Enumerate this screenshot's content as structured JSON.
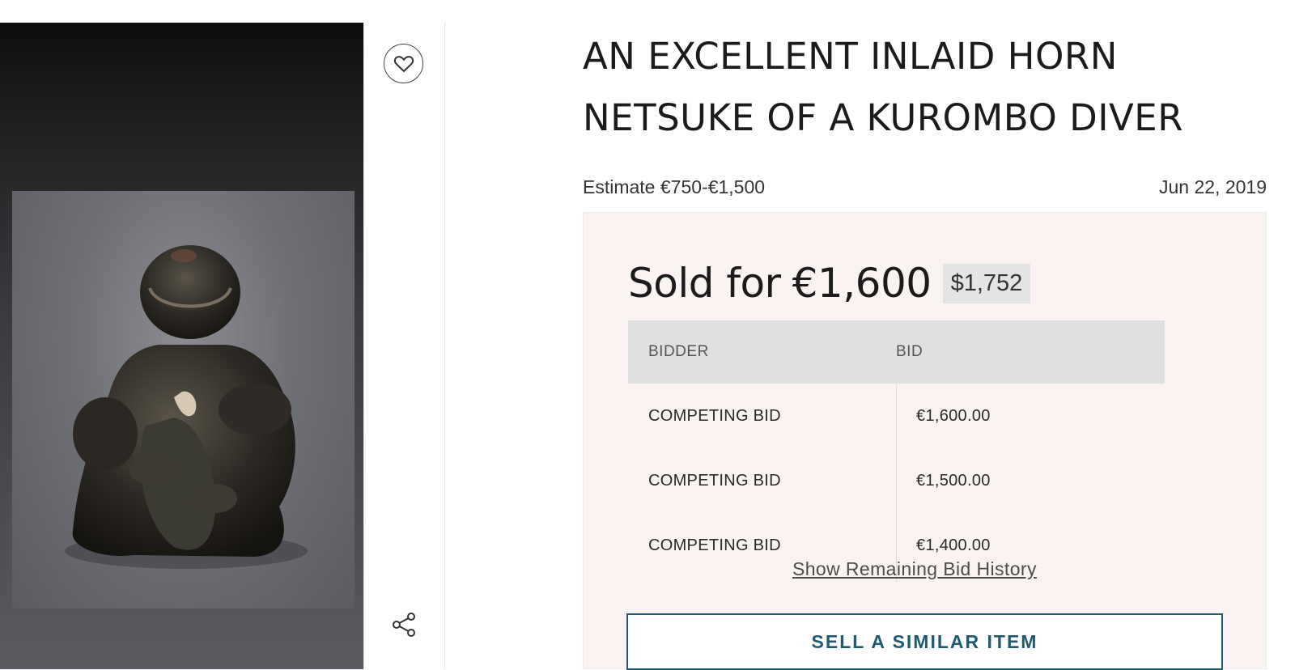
{
  "lot": {
    "title": "AN EXCELLENT INLAID HORN NETSUKE OF A KUROMBO DIVER",
    "estimate": "Estimate €750-€1,500",
    "date": "Jun 22, 2019",
    "image_alt_icon": "netsuke-figure-photo"
  },
  "actions": {
    "favorite_icon": "heart-icon",
    "share_icon": "share-icon"
  },
  "sale": {
    "sold_label": "Sold for",
    "sold_amount": "€1,600",
    "usd_amount": "$1,752",
    "table": {
      "headers": [
        "BIDDER",
        "BID"
      ],
      "rows": [
        {
          "bidder": "COMPETING BID",
          "bid": "€1,600.00"
        },
        {
          "bidder": "COMPETING BID",
          "bid": "€1,500.00"
        },
        {
          "bidder": "COMPETING BID",
          "bid": "€1,400.00"
        }
      ]
    },
    "history_link": "Show Remaining Bid History",
    "sell_button": "SELL A SIMILAR ITEM"
  },
  "colors": {
    "sale_box_bg": "#faf3f1",
    "accent": "#1e5a72"
  }
}
